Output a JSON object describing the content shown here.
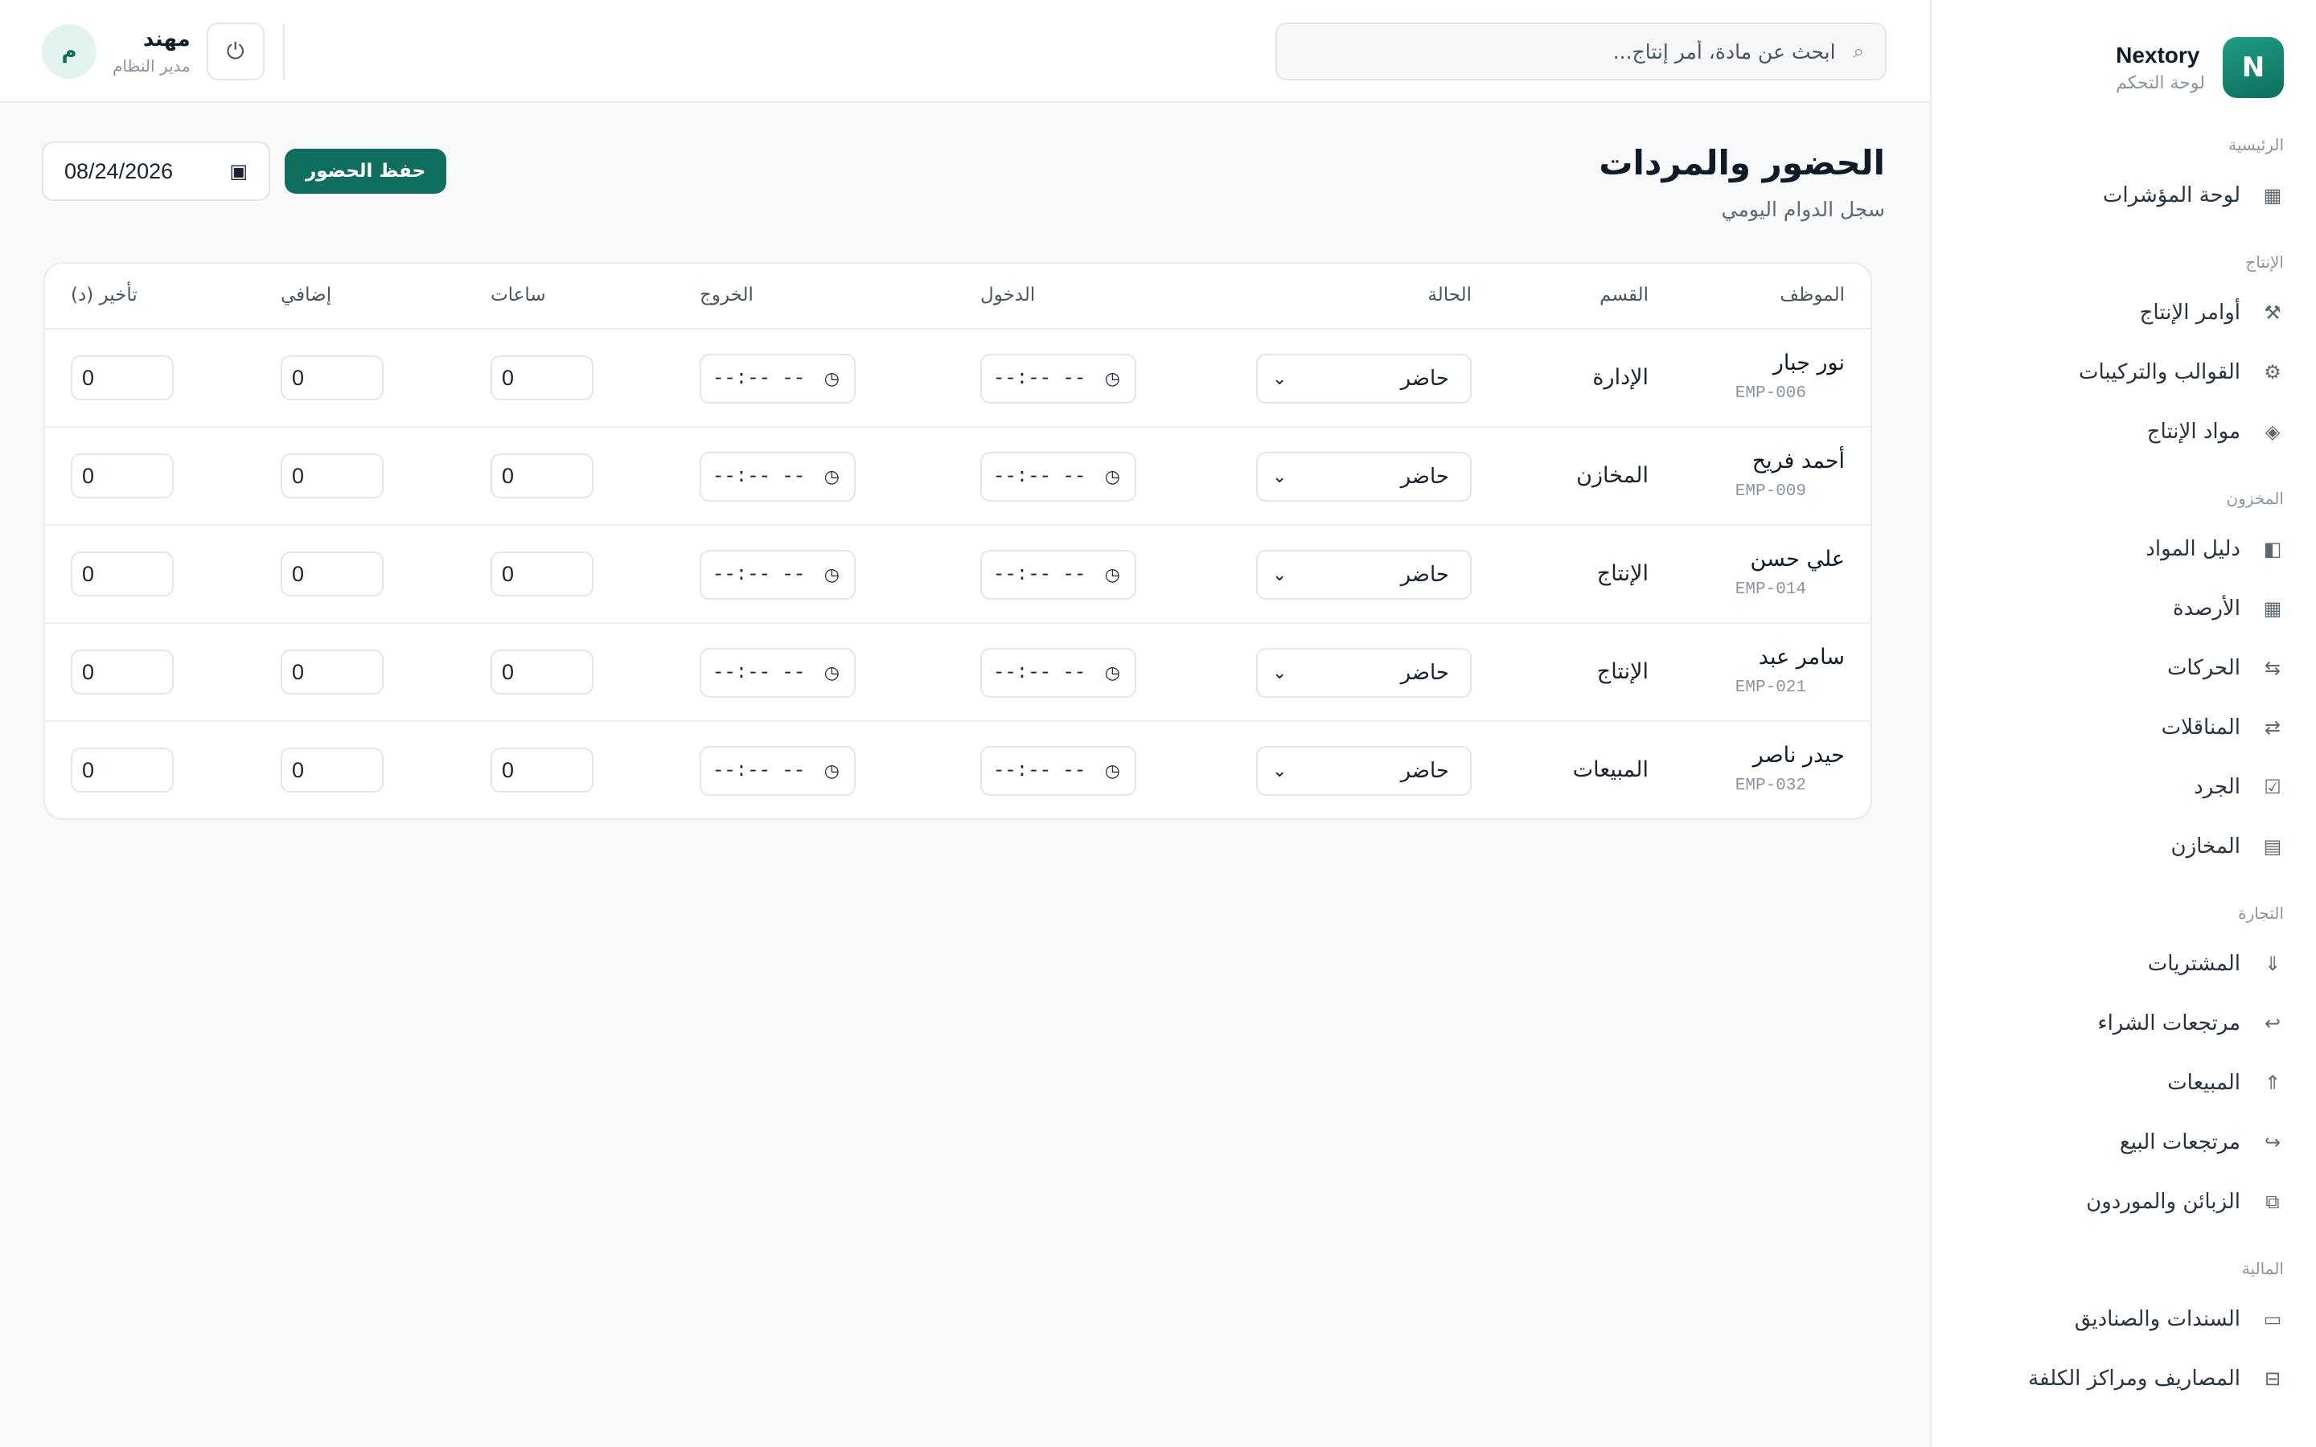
{
  "brand": {
    "logo_letter": "N",
    "name": "Nextory",
    "subtitle": "لوحة التحكم"
  },
  "search": {
    "placeholder": "ابحث عن مادة، أمر إنتاج...",
    "icon": "search-icon"
  },
  "user": {
    "name": "مهند",
    "role": "مدير النظام",
    "avatar_letter": "م"
  },
  "page": {
    "title": "الحضور والمردات",
    "subtitle": "سجل الدوام اليومي"
  },
  "actions": {
    "date": "08/24/2026",
    "save_label": "حفظ الحضور"
  },
  "colors": {
    "accent": "#0f6e5e",
    "accent_light": "#1f9d86",
    "avatar_bg": "#e3f3ef"
  },
  "sidebar": {
    "groups": [
      {
        "label": "الرئيسية",
        "items": [
          {
            "label": "لوحة المؤشرات",
            "icon": "grid-icon"
          }
        ]
      },
      {
        "label": "الإنتاج",
        "items": [
          {
            "label": "أوامر الإنتاج",
            "icon": "factory-icon"
          },
          {
            "label": "القوالب والتركيبات",
            "icon": "gear-icon"
          },
          {
            "label": "مواد الإنتاج",
            "icon": "diamond-icon"
          }
        ]
      },
      {
        "label": "المخزون",
        "items": [
          {
            "label": "دليل المواد",
            "icon": "book-icon"
          },
          {
            "label": "الأرصدة",
            "icon": "table-icon"
          },
          {
            "label": "الحركات",
            "icon": "shuffle-icon"
          },
          {
            "label": "المناقلات",
            "icon": "transfer-icon"
          },
          {
            "label": "الجرد",
            "icon": "checkbox-icon"
          },
          {
            "label": "المخازن",
            "icon": "warehouse-icon"
          }
        ]
      },
      {
        "label": "التجارة",
        "items": [
          {
            "label": "المشتريات",
            "icon": "arrow-down-icon"
          },
          {
            "label": "مرتجعات الشراء",
            "icon": "return-icon"
          },
          {
            "label": "المبيعات",
            "icon": "arrow-up-icon"
          },
          {
            "label": "مرتجعات البيع",
            "icon": "forward-icon"
          },
          {
            "label": "الزبائن والموردون",
            "icon": "contacts-icon"
          }
        ]
      },
      {
        "label": "المالية",
        "items": [
          {
            "label": "السندات والصناديق",
            "icon": "cash-icon"
          },
          {
            "label": "المصاريف ومراكز الكلفة",
            "icon": "ledger-icon"
          }
        ]
      }
    ]
  },
  "table": {
    "headers": {
      "employee": "الموظف",
      "department": "القسم",
      "status": "الحالة",
      "check_in": "الدخول",
      "check_out": "الخروج",
      "hours": "ساعات",
      "overtime": "إضافي",
      "late": "تأخير (د)"
    },
    "rows": [
      {
        "name": "نور جبار",
        "code": "EMP-006",
        "department": "الإدارة",
        "status": "حاضر",
        "check_in": "--:-- --",
        "check_out": "--:-- --",
        "hours": "0",
        "overtime": "0",
        "late": "0"
      },
      {
        "name": "أحمد فريح",
        "code": "EMP-009",
        "department": "المخازن",
        "status": "حاضر",
        "check_in": "--:-- --",
        "check_out": "--:-- --",
        "hours": "0",
        "overtime": "0",
        "late": "0"
      },
      {
        "name": "علي حسن",
        "code": "EMP-014",
        "department": "الإنتاج",
        "status": "حاضر",
        "check_in": "--:-- --",
        "check_out": "--:-- --",
        "hours": "0",
        "overtime": "0",
        "late": "0"
      },
      {
        "name": "سامر عبد",
        "code": "EMP-021",
        "department": "الإنتاج",
        "status": "حاضر",
        "check_in": "--:-- --",
        "check_out": "--:-- --",
        "hours": "0",
        "overtime": "0",
        "late": "0"
      },
      {
        "name": "حيدر ناصر",
        "code": "EMP-032",
        "department": "المبيعات",
        "status": "حاضر",
        "check_in": "--:-- --",
        "check_out": "--:-- --",
        "hours": "0",
        "overtime": "0",
        "late": "0"
      }
    ]
  }
}
